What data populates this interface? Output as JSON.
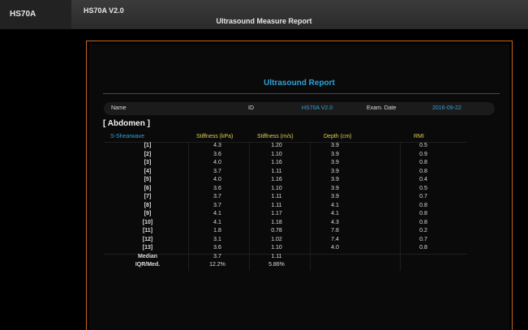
{
  "app": {
    "brand": "HS70A",
    "version": "HS70A V2.0",
    "window_title": "Ultrasound Measure Report"
  },
  "report": {
    "title": "Ultrasound Report",
    "info": {
      "name_label": "Name",
      "id_label": "ID",
      "id_value": "HS70A V2.0",
      "date_label": "Exam. Date",
      "date_value": "2016-09-22"
    },
    "section": "[ Abdomen ]",
    "table": {
      "headers": [
        "S-Shearwave",
        "Stiffness (kPa)",
        "Stiffness (m/s)",
        "Depth (cm)",
        "RMI"
      ],
      "rows": [
        [
          "[1]",
          "4.3",
          "1.20",
          "3.9",
          "0.5"
        ],
        [
          "[2]",
          "3.6",
          "1.10",
          "3.9",
          "0.9"
        ],
        [
          "[3]",
          "4.0",
          "1.16",
          "3.9",
          "0.8"
        ],
        [
          "[4]",
          "3.7",
          "1.11",
          "3.9",
          "0.8"
        ],
        [
          "[5]",
          "4.0",
          "1.16",
          "3.9",
          "0.4"
        ],
        [
          "[6]",
          "3.6",
          "1.10",
          "3.9",
          "0.5"
        ],
        [
          "[7]",
          "3.7",
          "1.11",
          "3.9",
          "0.7"
        ],
        [
          "[8]",
          "3.7",
          "1.11",
          "4.1",
          "0.8"
        ],
        [
          "[9]",
          "4.1",
          "1.17",
          "4.1",
          "0.8"
        ],
        [
          "[10]",
          "4.1",
          "1.18",
          "4.3",
          "0.8"
        ],
        [
          "[11]",
          "1.8",
          "0.78",
          "7.8",
          "0.2"
        ],
        [
          "[12]",
          "3.1",
          "1.02",
          "7.4",
          "0.7"
        ],
        [
          "[13]",
          "3.6",
          "1.10",
          "4.0",
          "0.8"
        ],
        [
          "Median",
          "3.7",
          "1.11",
          "",
          ""
        ],
        [
          "IQR/Med.",
          "12.2%",
          "5.86%",
          "",
          ""
        ]
      ]
    }
  },
  "colors": {
    "accent_blue": "#2ea3d6",
    "header_yellow": "#d9cf55",
    "frame_orange": "#c8661c"
  }
}
